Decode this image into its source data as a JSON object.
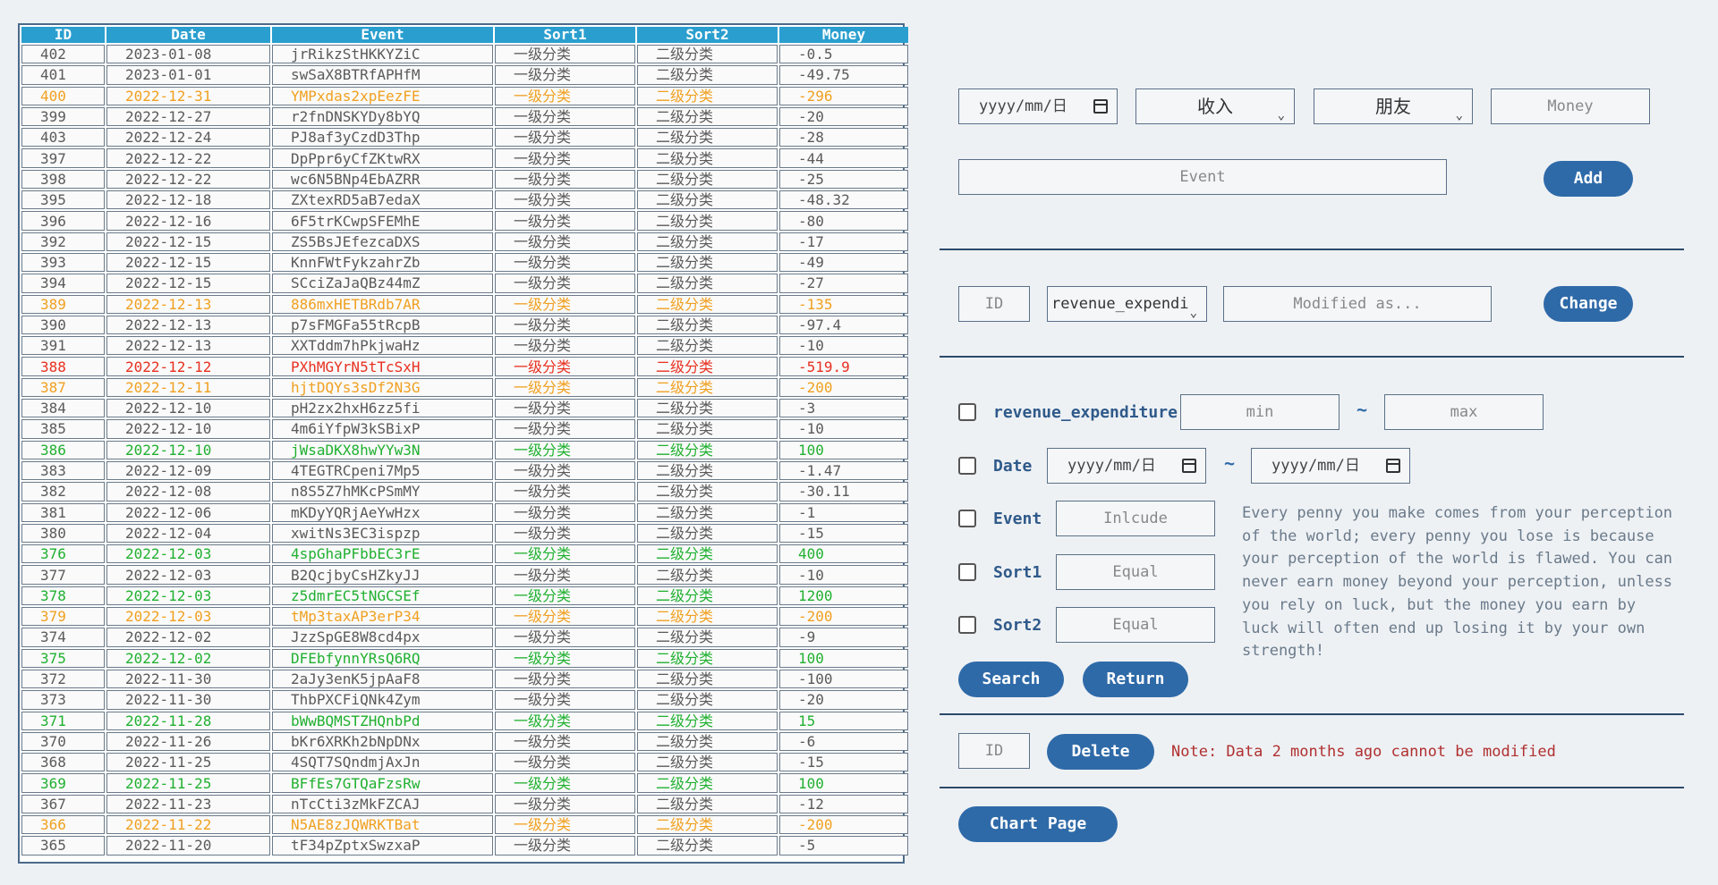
{
  "table": {
    "headers": [
      "ID",
      "Date",
      "Event",
      "Sort1",
      "Sort2",
      "Money"
    ],
    "rows": [
      {
        "id": "402",
        "date": "2023-01-08",
        "event": "jrRikzStHKKYZiC",
        "sort1": "一级分类",
        "sort2": "二级分类",
        "money": "-0.5",
        "style": "normal"
      },
      {
        "id": "401",
        "date": "2023-01-01",
        "event": "swSaX8BTRfAPHfM",
        "sort1": "一级分类",
        "sort2": "二级分类",
        "money": "-49.75",
        "style": "normal"
      },
      {
        "id": "400",
        "date": "2022-12-31",
        "event": "YMPxdas2xpEezFE",
        "sort1": "一级分类",
        "sort2": "二级分类",
        "money": "-296",
        "style": "orange"
      },
      {
        "id": "399",
        "date": "2022-12-27",
        "event": "r2fnDNSKYDy8bYQ",
        "sort1": "一级分类",
        "sort2": "二级分类",
        "money": "-20",
        "style": "normal"
      },
      {
        "id": "403",
        "date": "2022-12-24",
        "event": "PJ8af3yCzdD3Thp",
        "sort1": "一级分类",
        "sort2": "二级分类",
        "money": "-28",
        "style": "normal"
      },
      {
        "id": "397",
        "date": "2022-12-22",
        "event": "DpPpr6yCfZKtwRX",
        "sort1": "一级分类",
        "sort2": "二级分类",
        "money": "-44",
        "style": "normal"
      },
      {
        "id": "398",
        "date": "2022-12-22",
        "event": "wc6N5BNp4EbAZRR",
        "sort1": "一级分类",
        "sort2": "二级分类",
        "money": "-25",
        "style": "normal"
      },
      {
        "id": "395",
        "date": "2022-12-18",
        "event": "ZXtexRD5aB7edaX",
        "sort1": "一级分类",
        "sort2": "二级分类",
        "money": "-48.32",
        "style": "normal"
      },
      {
        "id": "396",
        "date": "2022-12-16",
        "event": "6F5trKCwpSFEMhE",
        "sort1": "一级分类",
        "sort2": "二级分类",
        "money": "-80",
        "style": "normal"
      },
      {
        "id": "392",
        "date": "2022-12-15",
        "event": "ZS5BsJEfezcaDXS",
        "sort1": "一级分类",
        "sort2": "二级分类",
        "money": "-17",
        "style": "normal"
      },
      {
        "id": "393",
        "date": "2022-12-15",
        "event": "KnnFWtFykzahrZb",
        "sort1": "一级分类",
        "sort2": "二级分类",
        "money": "-49",
        "style": "normal"
      },
      {
        "id": "394",
        "date": "2022-12-15",
        "event": "SCciZaJaQBz44mZ",
        "sort1": "一级分类",
        "sort2": "二级分类",
        "money": "-27",
        "style": "normal"
      },
      {
        "id": "389",
        "date": "2022-12-13",
        "event": "886mxHETBRdb7AR",
        "sort1": "一级分类",
        "sort2": "二级分类",
        "money": "-135",
        "style": "orange"
      },
      {
        "id": "390",
        "date": "2022-12-13",
        "event": "p7sFMGFa55tRcpB",
        "sort1": "一级分类",
        "sort2": "二级分类",
        "money": "-97.4",
        "style": "normal"
      },
      {
        "id": "391",
        "date": "2022-12-13",
        "event": "XXTddm7hPkjwaHz",
        "sort1": "一级分类",
        "sort2": "二级分类",
        "money": "-10",
        "style": "normal"
      },
      {
        "id": "388",
        "date": "2022-12-12",
        "event": "PXhMGYrN5tTcSxH",
        "sort1": "一级分类",
        "sort2": "二级分类",
        "money": "-519.9",
        "style": "red"
      },
      {
        "id": "387",
        "date": "2022-12-11",
        "event": "hjtDQYs3sDf2N3G",
        "sort1": "一级分类",
        "sort2": "二级分类",
        "money": "-200",
        "style": "orange"
      },
      {
        "id": "384",
        "date": "2022-12-10",
        "event": "pH2zx2hxH6zz5fi",
        "sort1": "一级分类",
        "sort2": "二级分类",
        "money": "-3",
        "style": "normal"
      },
      {
        "id": "385",
        "date": "2022-12-10",
        "event": "4m6iYfpW3kSBixP",
        "sort1": "一级分类",
        "sort2": "二级分类",
        "money": "-10",
        "style": "normal"
      },
      {
        "id": "386",
        "date": "2022-12-10",
        "event": "jWsaDKX8hwYYw3N",
        "sort1": "一级分类",
        "sort2": "二级分类",
        "money": "100",
        "style": "green"
      },
      {
        "id": "383",
        "date": "2022-12-09",
        "event": "4TEGTRCpeni7Mp5",
        "sort1": "一级分类",
        "sort2": "二级分类",
        "money": "-1.47",
        "style": "normal"
      },
      {
        "id": "382",
        "date": "2022-12-08",
        "event": "n8S5Z7hMKcPSmMY",
        "sort1": "一级分类",
        "sort2": "二级分类",
        "money": "-30.11",
        "style": "normal"
      },
      {
        "id": "381",
        "date": "2022-12-06",
        "event": "mKDyYQRjAeYwHzx",
        "sort1": "一级分类",
        "sort2": "二级分类",
        "money": "-1",
        "style": "normal"
      },
      {
        "id": "380",
        "date": "2022-12-04",
        "event": "xwitNs3EC3ispzp",
        "sort1": "一级分类",
        "sort2": "二级分类",
        "money": "-15",
        "style": "normal"
      },
      {
        "id": "376",
        "date": "2022-12-03",
        "event": "4spGhaPFbbEC3rE",
        "sort1": "一级分类",
        "sort2": "二级分类",
        "money": "400",
        "style": "green"
      },
      {
        "id": "377",
        "date": "2022-12-03",
        "event": "B2QcjbyCsHZkyJJ",
        "sort1": "一级分类",
        "sort2": "二级分类",
        "money": "-10",
        "style": "normal"
      },
      {
        "id": "378",
        "date": "2022-12-03",
        "event": "z5dmrEC5tNGCSEf",
        "sort1": "一级分类",
        "sort2": "二级分类",
        "money": "1200",
        "style": "green"
      },
      {
        "id": "379",
        "date": "2022-12-03",
        "event": "tMp3taxAP3erP34",
        "sort1": "一级分类",
        "sort2": "二级分类",
        "money": "-200",
        "style": "orange"
      },
      {
        "id": "374",
        "date": "2022-12-02",
        "event": "JzzSpGE8W8cd4px",
        "sort1": "一级分类",
        "sort2": "二级分类",
        "money": "-9",
        "style": "normal"
      },
      {
        "id": "375",
        "date": "2022-12-02",
        "event": "DFEbfynnYRsQ6RQ",
        "sort1": "一级分类",
        "sort2": "二级分类",
        "money": "100",
        "style": "green"
      },
      {
        "id": "372",
        "date": "2022-11-30",
        "event": "2aJy3enK5jpAaF8",
        "sort1": "一级分类",
        "sort2": "二级分类",
        "money": "-100",
        "style": "normal"
      },
      {
        "id": "373",
        "date": "2022-11-30",
        "event": "ThbPXCFiQNk4Zym",
        "sort1": "一级分类",
        "sort2": "二级分类",
        "money": "-20",
        "style": "normal"
      },
      {
        "id": "371",
        "date": "2022-11-28",
        "event": "bWwBQMSTZHQnbPd",
        "sort1": "一级分类",
        "sort2": "二级分类",
        "money": "15",
        "style": "green"
      },
      {
        "id": "370",
        "date": "2022-11-26",
        "event": "bKr6XRKh2bNpDNx",
        "sort1": "一级分类",
        "sort2": "二级分类",
        "money": "-6",
        "style": "normal"
      },
      {
        "id": "368",
        "date": "2022-11-25",
        "event": "4SQT7SQndmjAxJn",
        "sort1": "一级分类",
        "sort2": "二级分类",
        "money": "-15",
        "style": "normal"
      },
      {
        "id": "369",
        "date": "2022-11-25",
        "event": "BFfEs7GTQaFzsRw",
        "sort1": "一级分类",
        "sort2": "二级分类",
        "money": "100",
        "style": "green"
      },
      {
        "id": "367",
        "date": "2022-11-23",
        "event": "nTcCti3zMkFZCAJ",
        "sort1": "一级分类",
        "sort2": "二级分类",
        "money": "-12",
        "style": "normal"
      },
      {
        "id": "366",
        "date": "2022-11-22",
        "event": "N5AE8zJQWRKTBat",
        "sort1": "一级分类",
        "sort2": "二级分类",
        "money": "-200",
        "style": "orange"
      },
      {
        "id": "365",
        "date": "2022-11-20",
        "event": "tF34pZptxSwzxaP",
        "sort1": "一级分类",
        "sort2": "二级分类",
        "money": "-5",
        "style": "normal"
      }
    ]
  },
  "add_form": {
    "date_placeholder": "yyyy/mm/日",
    "type_selected": "收入",
    "category_selected": "朋友",
    "money_placeholder": "Money",
    "event_placeholder": "Event",
    "add_label": "Add"
  },
  "change_form": {
    "id_placeholder": "ID",
    "field_selected": "revenue_expendi",
    "modified_placeholder": "Modified as...",
    "change_label": "Change"
  },
  "search_form": {
    "revenue_label": "revenue_expenditure",
    "min_placeholder": "min",
    "max_placeholder": "max",
    "tilde": "~",
    "date_label": "Date",
    "date_from_placeholder": "yyyy/mm/日",
    "date_to_placeholder": "yyyy/mm/日",
    "event_label": "Event",
    "event_placeholder": "Inlcude",
    "sort1_label": "Sort1",
    "sort1_placeholder": "Equal",
    "sort2_label": "Sort2",
    "sort2_placeholder": "Equal",
    "search_label": "Search",
    "return_label": "Return",
    "quote": "Every penny you make comes from your perception of the world; every penny you lose is because your perception of the world is flawed. You can never earn money beyond your perception, unless you rely on luck, but the money you earn by luck will often end up losing it by your own strength!"
  },
  "delete_form": {
    "id_placeholder": "ID",
    "delete_label": "Delete",
    "note": "Note: Data 2 months ago cannot be modified"
  },
  "chart_button": {
    "label": "Chart Page"
  },
  "colors": {
    "header_bg": "#2a9fcf",
    "button_bg": "#2f6aa8",
    "expense_large": "#f0a020",
    "expense_max": "#e83020",
    "income": "#20b030",
    "note": "#b03030"
  },
  "icons": {
    "calendar": "calendar-icon",
    "dropdown": "chevron-down-icon"
  }
}
